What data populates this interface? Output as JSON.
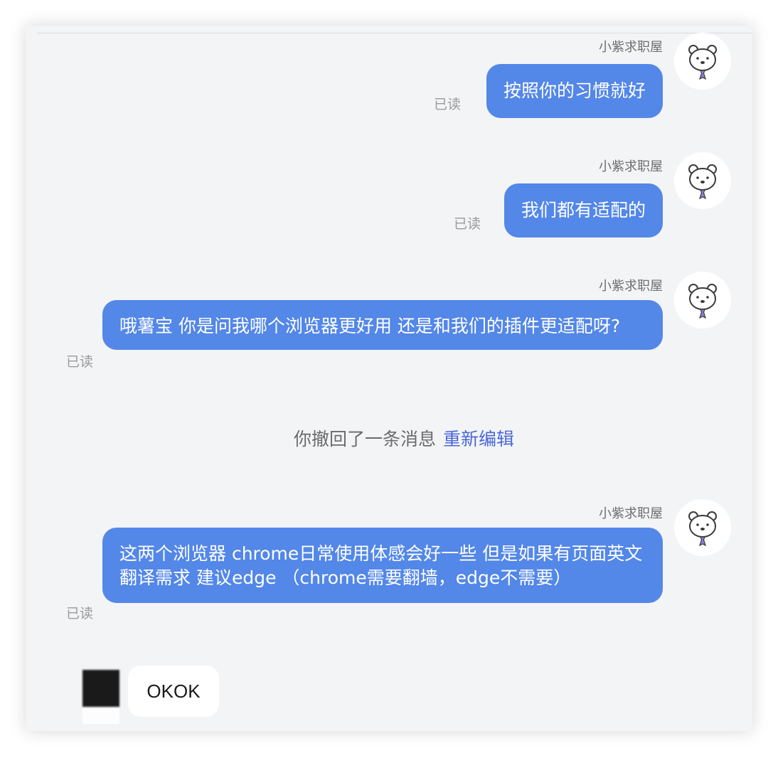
{
  "messages": [
    {
      "sender": "小紫求职屋",
      "text": "按照你的习惯就好",
      "status": "已读"
    },
    {
      "sender": "小紫求职屋",
      "text": "我们都有适配的",
      "status": "已读"
    },
    {
      "sender": "小紫求职屋",
      "text": "哦薯宝 你是问我哪个浏览器更好用 还是和我们的插件更适配呀?",
      "status": "已读"
    },
    {
      "sender": "小紫求职屋",
      "text": "这两个浏览器 chrome日常使用体感会好一些 但是如果有页面英文翻译需求 建议edge （chrome需要翻墙，edge不需要）",
      "status": "已读"
    }
  ],
  "recall": {
    "text": "你撤回了一条消息",
    "link": "重新编辑"
  },
  "reply": {
    "text": "OKOK"
  },
  "colors": {
    "bubble": "#5387e8",
    "background": "#f3f4f6",
    "link": "#4a68d8"
  },
  "icons": {
    "agent_avatar": "bear-with-tie-icon"
  }
}
